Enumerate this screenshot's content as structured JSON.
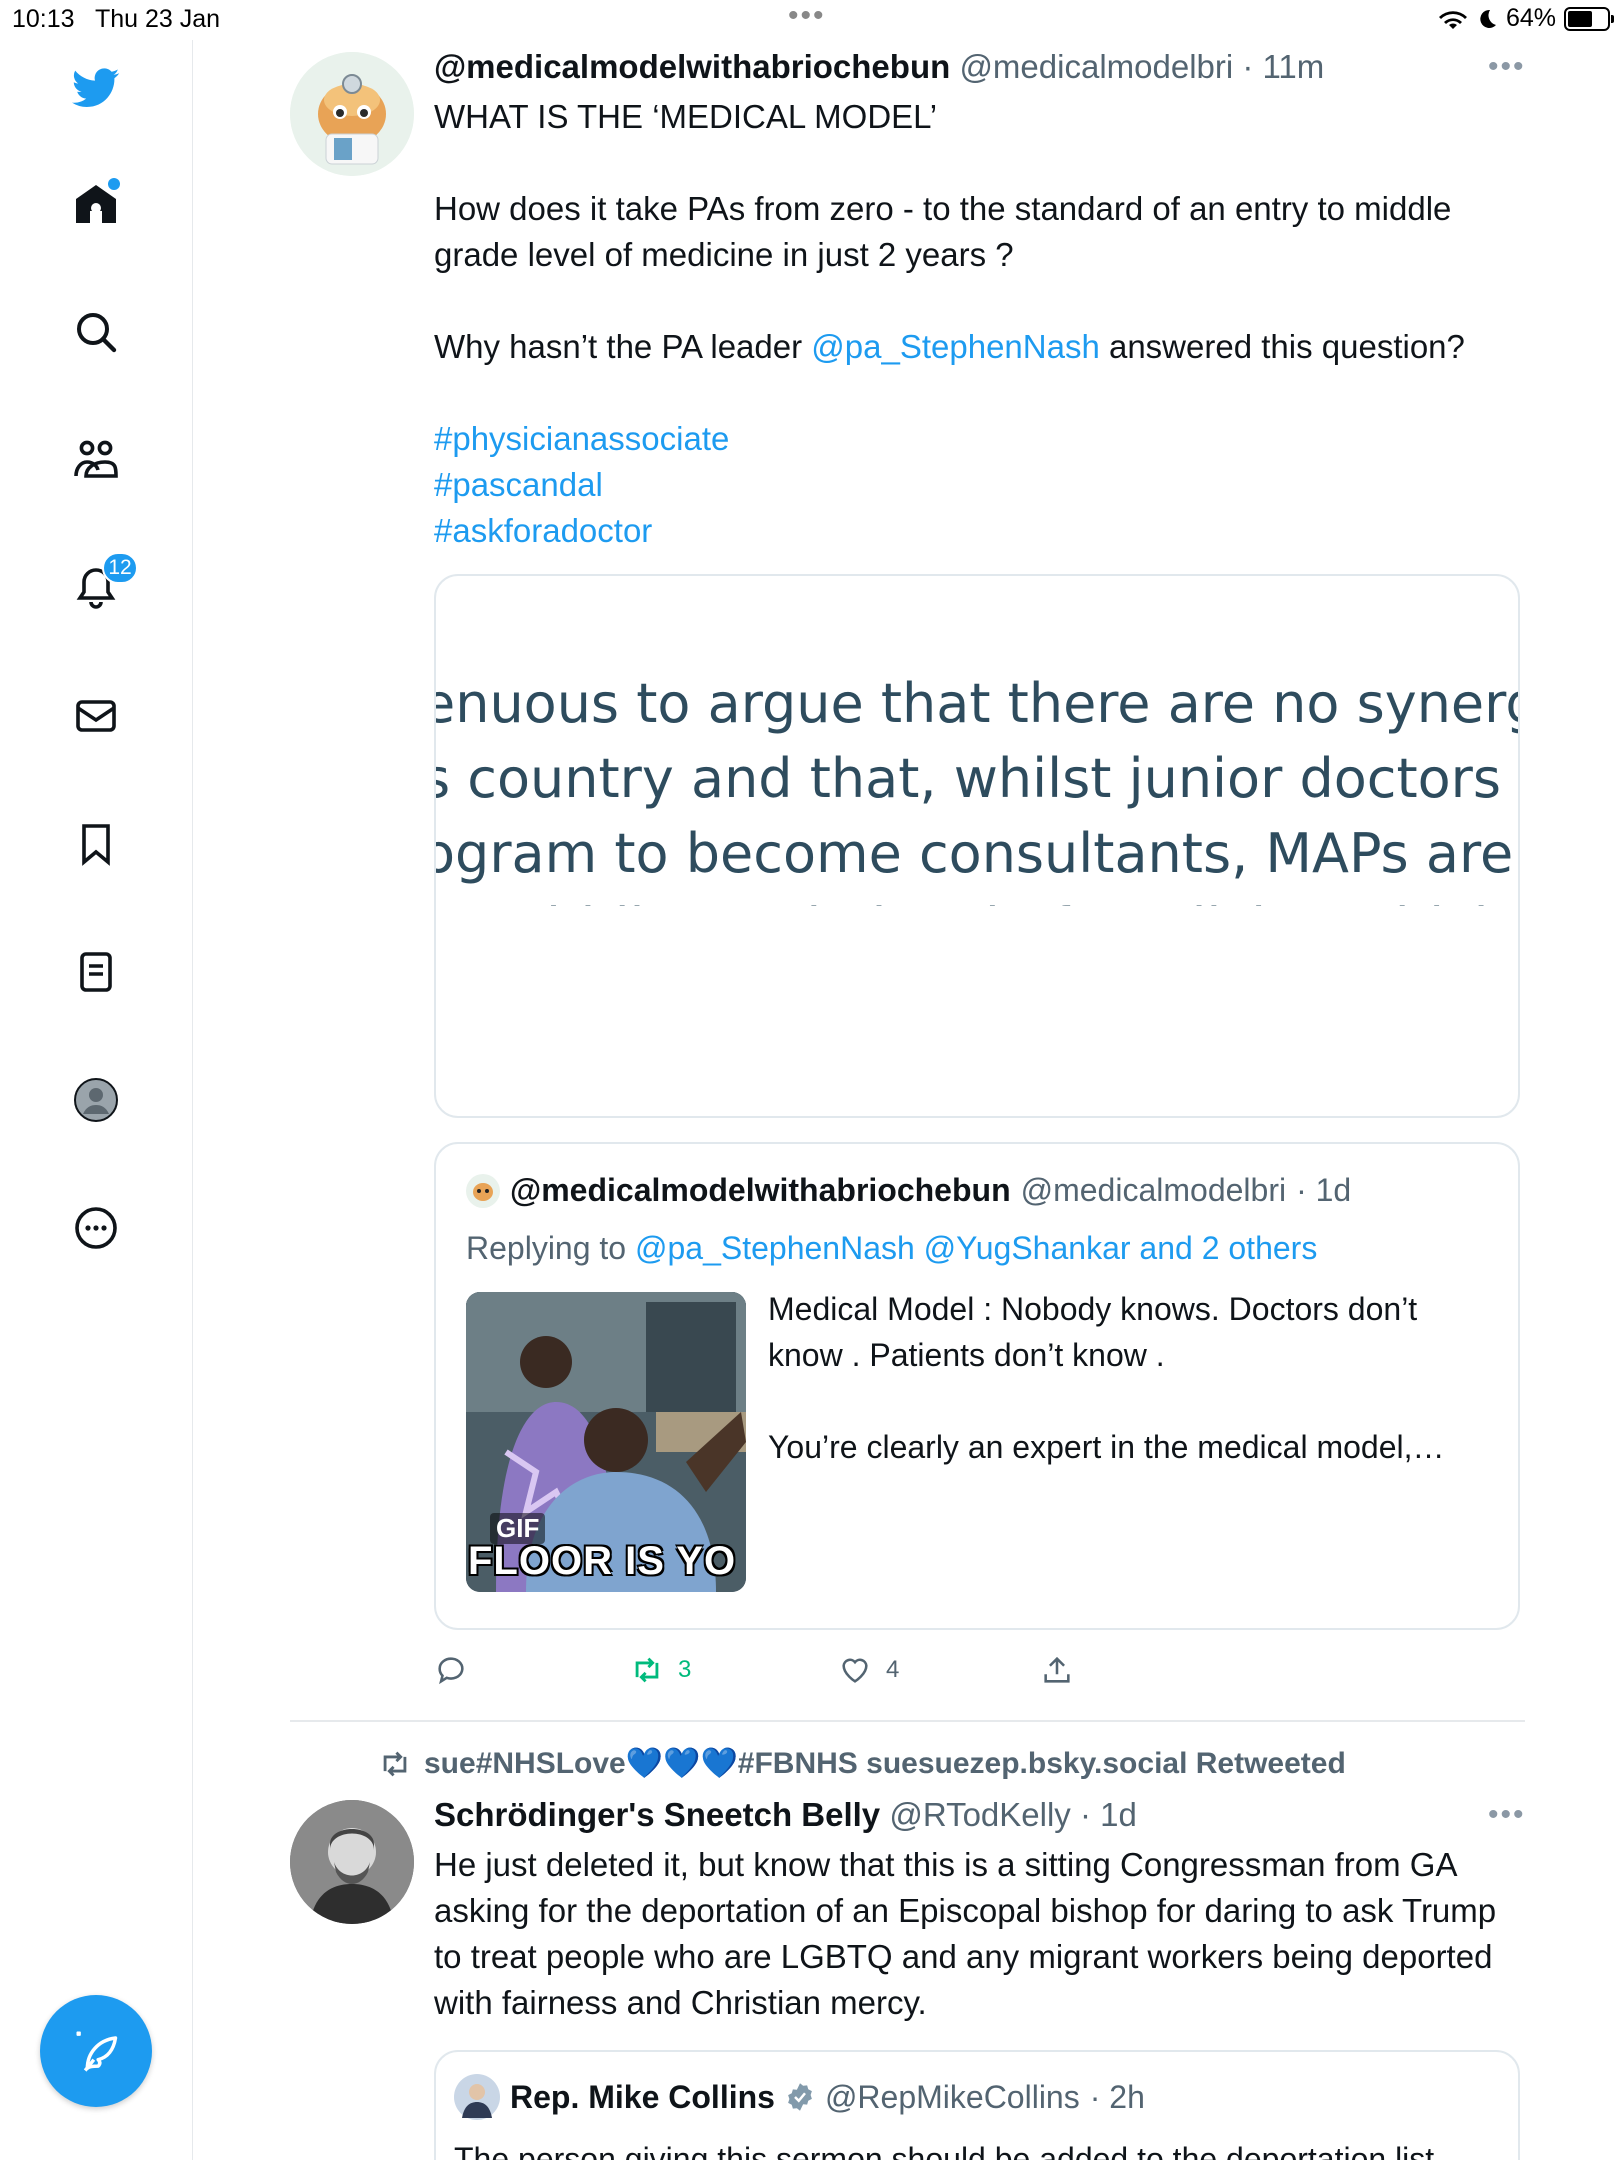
{
  "status_bar": {
    "time": "10:13",
    "date": "Thu 23 Jan",
    "battery": "64%"
  },
  "sidebar": {
    "notifications_count": "12",
    "items": [
      {
        "icon": "twitter-bird-icon"
      },
      {
        "icon": "home-icon"
      },
      {
        "icon": "search-icon"
      },
      {
        "icon": "communities-icon"
      },
      {
        "icon": "notifications-icon"
      },
      {
        "icon": "messages-icon"
      },
      {
        "icon": "bookmarks-icon"
      },
      {
        "icon": "lists-icon"
      },
      {
        "icon": "profile-icon"
      },
      {
        "icon": "more-icon"
      }
    ],
    "compose_icon": "compose-tweet-icon"
  },
  "tweet1": {
    "display_name": "@medicalmodelwithabriochebun",
    "handle": "@medicalmodelbri",
    "time": "· 11m",
    "line1": "WHAT IS THE ‘MEDICAL MODEL’",
    "line2": "How does it take PAs from zero - to the standard of an entry to middle grade level of medicine in just 2 years ?",
    "line3_pre": "Why hasn’t the PA leader ",
    "line3_mention": "@pa_StephenNash",
    "line3_post": " answered this question?",
    "hashtags": [
      "#physicianassociate",
      "#pascandal",
      "#askforadoctor"
    ],
    "image_text": [
      "enuous to argue that there are no synergist",
      "s country and that, whilst junior doctors ar",
      "ogram to become consultants, MAPs are pr",
      "to middle-grade level of medicine which th"
    ],
    "quote": {
      "display_name": "@medicalmodelwithabriochebun",
      "handle": "@medicalmodelbri",
      "time": "· 1d",
      "replying_prefix": "Replying to ",
      "replying_mentions": "@pa_StephenNash @YugShankar and 2 others",
      "text1": "Medical Model : Nobody knows. Doctors don’t know . Patients don’t know .",
      "text2": "You’re clearly an expert in the medical model,…",
      "gif_label": "GIF",
      "gif_caption": "FLOOR IS YO"
    },
    "actions": {
      "reply_count": "",
      "retweet_count": "3",
      "like_count": "4"
    }
  },
  "tweet2": {
    "retweeted_by": "sue#NHSLove💙💙💙#FBNHS suesuezep.bsky.social Retweeted",
    "display_name": "Schrödinger's Sneetch Belly",
    "handle": "@RTodKelly",
    "time": "· 1d",
    "text": "He just deleted it, but know that this is a sitting Congressman from GA asking for the deportation of an Episcopal bishop for daring to ask Trump to treat people who are LGBTQ and any migrant workers being deported with fairness and Christian mercy.",
    "quote": {
      "display_name": "Rep. Mike Collins",
      "handle": "@RepMikeCollins",
      "time": "· 2h",
      "text": "The person giving this sermon should be added to the deportation list."
    }
  },
  "colors": {
    "accent": "#1d9bf0",
    "retweet_green": "#00ba7c",
    "muted": "#536471"
  }
}
